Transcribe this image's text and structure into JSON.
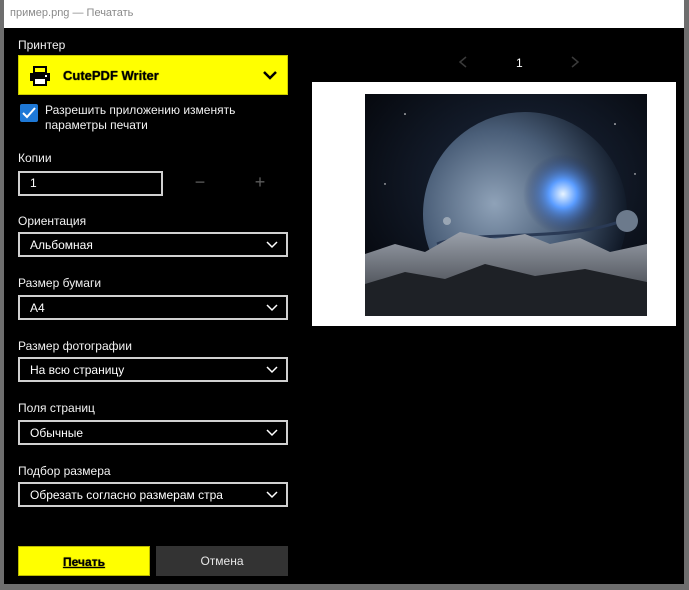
{
  "window": {
    "title": "пример.png — Печатать"
  },
  "printer": {
    "label": "Принтер",
    "selected": "CutePDF Writer"
  },
  "allow_app_settings": {
    "checked": true,
    "label": "Разрешить приложению изменять параметры печати"
  },
  "copies": {
    "label": "Копии",
    "value": "1",
    "decrement": "−",
    "increment": "+"
  },
  "orientation": {
    "label": "Ориентация",
    "value": "Альбомная"
  },
  "paper_size": {
    "label": "Размер бумаги",
    "value": "A4"
  },
  "photo_size": {
    "label": "Размер фотографии",
    "value": "На всю страницу"
  },
  "margins": {
    "label": "Поля страниц",
    "value": "Обычные"
  },
  "fit": {
    "label": "Подбор размера",
    "value": "Обрезать согласно размерам стра"
  },
  "preview": {
    "page_number": "1"
  },
  "buttons": {
    "print": "Печать",
    "cancel": "Отмена"
  },
  "colors": {
    "accent": "#ffff00",
    "checkbox": "#1e78d6",
    "background": "#000000"
  },
  "icons": [
    "printer-icon",
    "chevron-down-icon",
    "checkmark-icon",
    "minus-icon",
    "plus-icon",
    "chevron-left-icon",
    "chevron-right-icon"
  ]
}
